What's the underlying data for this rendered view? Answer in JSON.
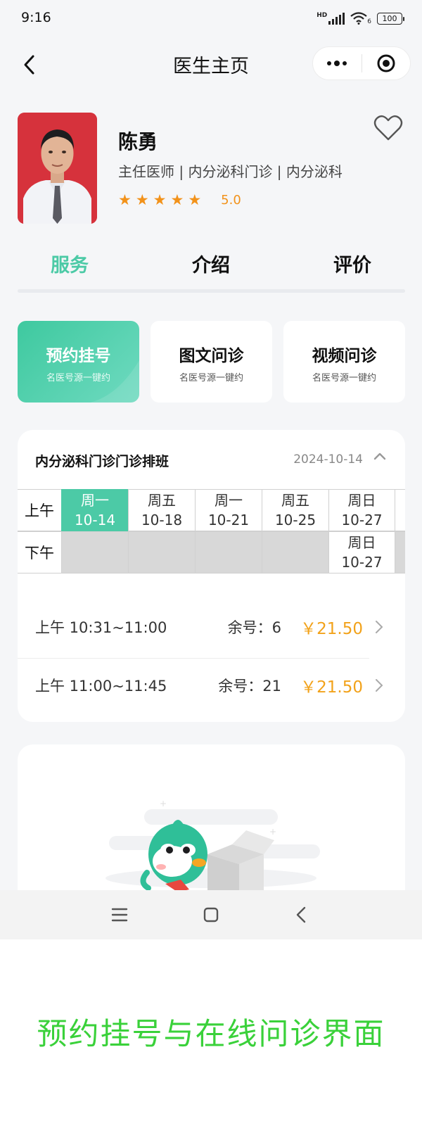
{
  "status_bar": {
    "time": "9:16",
    "battery": "100",
    "network_badge": "HD",
    "wifi_badge": "6"
  },
  "nav": {
    "title": "医生主页"
  },
  "doctor": {
    "name": "陈勇",
    "title_line": "主任医师 | 内分泌科门诊 | 内分泌科",
    "rating": "5.0",
    "stars": 5
  },
  "tabs": [
    {
      "label": "服务",
      "active": true
    },
    {
      "label": "介绍",
      "active": false
    },
    {
      "label": "评价",
      "active": false
    }
  ],
  "services": [
    {
      "title": "预约挂号",
      "subtitle": "名医号源一键约",
      "active": true
    },
    {
      "title": "图文问诊",
      "subtitle": "名医号源一键约",
      "active": false
    },
    {
      "title": "视频问诊",
      "subtitle": "名医号源一键约",
      "active": false
    }
  ],
  "schedule": {
    "title": "内分泌科门诊门诊排班",
    "date": "2024-10-14",
    "row_labels": {
      "morning": "上午",
      "afternoon": "下午"
    },
    "morning": [
      {
        "day": "周一",
        "date": "10-14",
        "selected": true
      },
      {
        "day": "周五",
        "date": "10-18"
      },
      {
        "day": "周一",
        "date": "10-21"
      },
      {
        "day": "周五",
        "date": "10-25"
      },
      {
        "day": "周日",
        "date": "10-27"
      }
    ],
    "afternoon": [
      {
        "available": false
      },
      {
        "available": false
      },
      {
        "available": false
      },
      {
        "available": false
      },
      {
        "day": "周日",
        "date": "10-27",
        "available": true
      }
    ],
    "slots": [
      {
        "time": "上午 10:31~11:00",
        "remaining": "余号：6",
        "price": "￥21.50"
      },
      {
        "time": "上午 11:00~11:45",
        "remaining": "余号：21",
        "price": "￥21.50"
      }
    ]
  },
  "caption": "预约挂号与在线问诊界面",
  "colors": {
    "accent": "#4ccaa6",
    "star": "#f2921a",
    "price": "#f2a21a",
    "caption": "#3ad13a"
  }
}
